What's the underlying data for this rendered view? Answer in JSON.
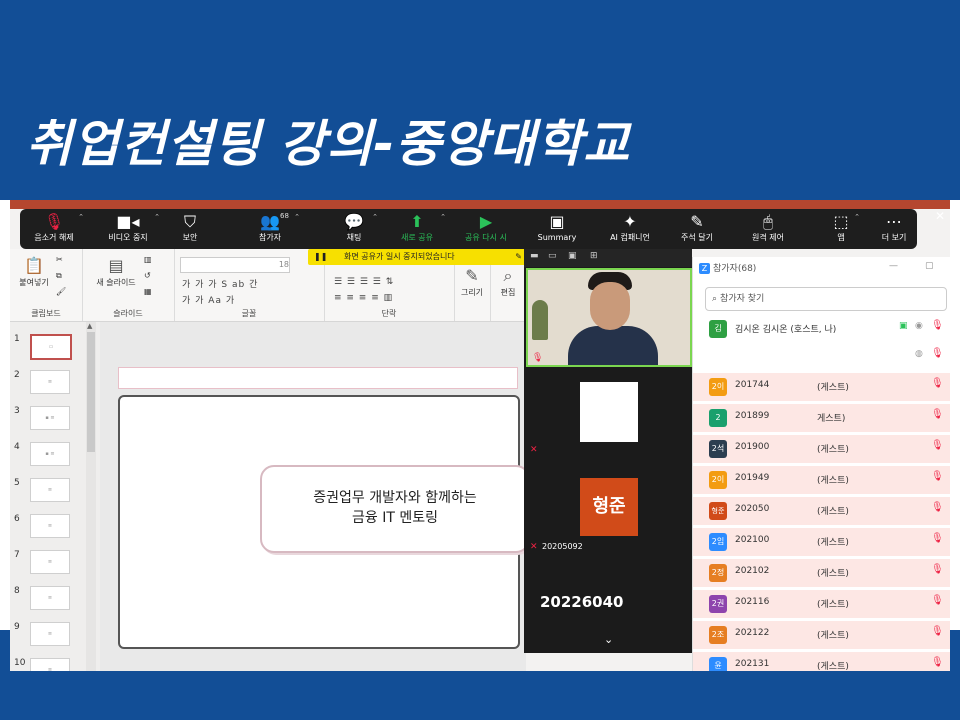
{
  "slide": {
    "title": "취업컨설팅 강의-중앙대학교"
  },
  "zoom_toolbar": {
    "items": [
      {
        "label": "음소거 해제",
        "icon": "mic-off-icon"
      },
      {
        "label": "비디오 중지",
        "icon": "video-camera-icon"
      },
      {
        "label": "보안",
        "icon": "shield-icon"
      },
      {
        "label": "참가자",
        "icon": "participants-icon",
        "count": "68"
      },
      {
        "label": "채팅",
        "icon": "chat-icon"
      },
      {
        "label": "새로 공유",
        "icon": "share-up-icon"
      },
      {
        "label": "공유 다시 시",
        "icon": "play-icon"
      },
      {
        "label": "Summary",
        "icon": "summary-icon"
      },
      {
        "label": "AI 컴패니언",
        "icon": "sparkle-icon"
      },
      {
        "label": "주석 달기",
        "icon": "pen-icon"
      },
      {
        "label": "원격 제어",
        "icon": "mouse-icon"
      },
      {
        "label": "앱",
        "icon": "apps-icon"
      },
      {
        "label": "더 보기",
        "icon": "more-icon"
      }
    ],
    "accent_green": "#2bc25a"
  },
  "share_banner": {
    "text": "화면 공유가 일시 중지되었습니다"
  },
  "ribbon": {
    "groups": [
      {
        "label": "클립보드",
        "button": "붙여넣기"
      },
      {
        "label": "슬라이드",
        "button": "새 슬라이드"
      },
      {
        "label": "글꼴"
      },
      {
        "label": "단락"
      },
      {
        "label": "",
        "button": "그리기"
      },
      {
        "label": "",
        "button": "편집"
      }
    ],
    "font_size": "18",
    "font_row1": "가 가 가 S ab 간",
    "font_row2": "가 가 Aa 가"
  },
  "thumbnails": {
    "numbers": [
      "1",
      "2",
      "3",
      "4",
      "5",
      "6",
      "7",
      "8",
      "9",
      "10"
    ]
  },
  "slide_content": {
    "line1": "증권업무 개발자와 함께하는",
    "line2": "금융 IT 멘토링"
  },
  "video_panel": {
    "avatar_text": "형준",
    "tile_name": "20205092",
    "big_name": "20226040"
  },
  "participants": {
    "title": "참가자(68)",
    "search_placeholder": "참가자 찾기",
    "host": {
      "initial": "김",
      "name": "김시온 김시온 (호스트, 나)",
      "color": "#2ea043"
    },
    "guests": [
      {
        "initial": "2이",
        "name": "201744",
        "role": "(게스트)",
        "color": "#f39c12"
      },
      {
        "initial": "2",
        "name": "201899",
        "role": "게스트)",
        "color": "#1aa06d"
      },
      {
        "initial": "2석",
        "name": "201900",
        "role": "(게스트)",
        "color": "#2c3e50"
      },
      {
        "initial": "2이",
        "name": "201949",
        "role": "(게스트)",
        "color": "#f39c12"
      },
      {
        "initial": "형준",
        "name": "202050",
        "role": "(게스트)",
        "color": "#d14b19"
      },
      {
        "initial": "2임",
        "name": "202100",
        "role": "(게스트)",
        "color": "#2d8cff"
      },
      {
        "initial": "2정",
        "name": "202102",
        "role": "(게스트)",
        "color": "#e67e22"
      },
      {
        "initial": "2권",
        "name": "202116",
        "role": "(게스트)",
        "color": "#8e44ad"
      },
      {
        "initial": "2조",
        "name": "202122",
        "role": "(게스트)",
        "color": "#e67e22"
      },
      {
        "initial": "윤",
        "name": "202131",
        "role": "(게스트)",
        "color": "#2d8cff"
      }
    ]
  },
  "colors": {
    "slide_blue": "#124e96",
    "ppt_accent": "#b5462f",
    "avatar_orange": "#d14b19"
  }
}
